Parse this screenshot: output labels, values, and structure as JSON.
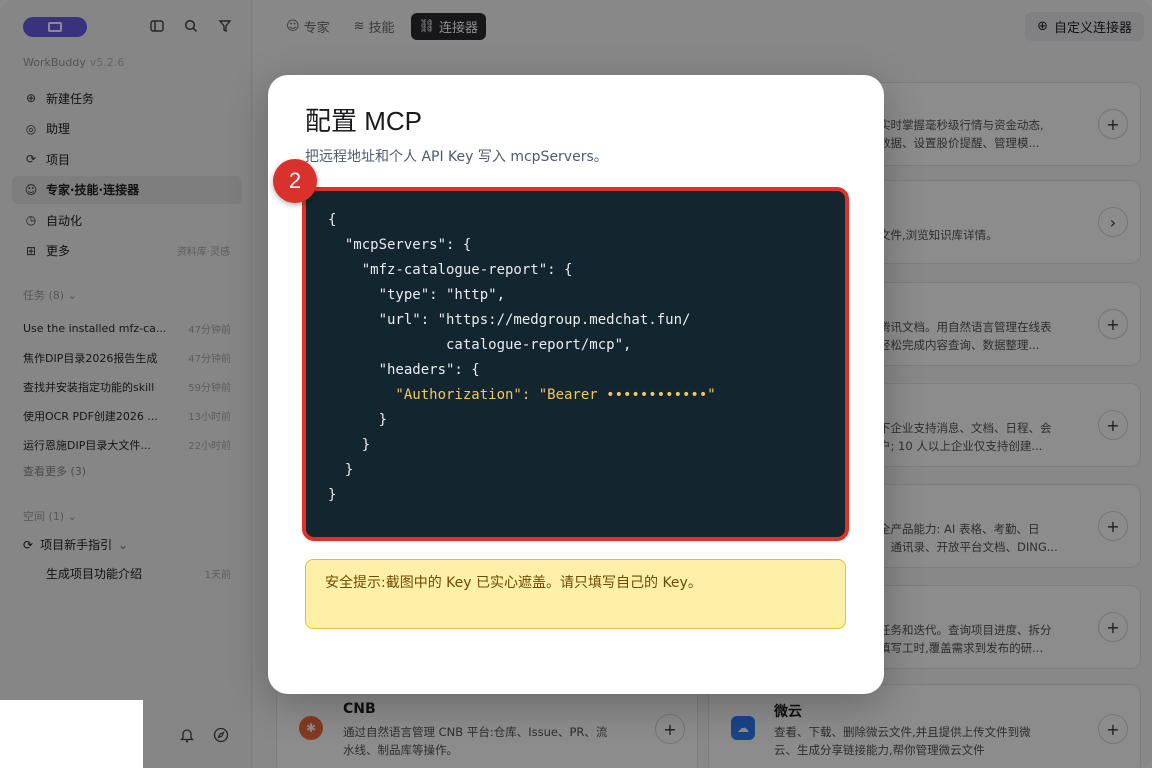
{
  "app": {
    "name": "WorkBuddy",
    "version": "v5.2.6"
  },
  "sidebar": {
    "nav": [
      {
        "label": "新建任务",
        "icon": "plus-circle-icon"
      },
      {
        "label": "助理",
        "icon": "assistant-icon"
      },
      {
        "label": "项目",
        "icon": "project-icon"
      },
      {
        "label": "专家·技能·连接器",
        "icon": "expert-icon"
      },
      {
        "label": "自动化",
        "icon": "clock-icon"
      },
      {
        "label": "更多",
        "icon": "grid-icon",
        "extra": "资料库·灵感"
      }
    ],
    "tasks_header": "任务 (8)",
    "tasks": [
      {
        "title": "Use the installed mfz-ca...",
        "time": "47分钟前"
      },
      {
        "title": "焦作DIP目录2026报告生成",
        "time": "47分钟前"
      },
      {
        "title": "查找并安装指定功能的skill",
        "time": "59分钟前"
      },
      {
        "title": "使用OCR PDF创建2026 ...",
        "time": "13小时前"
      },
      {
        "title": "运行恩施DIP目录大文件...",
        "time": "22小时前"
      }
    ],
    "see_more": "查看更多 (3)",
    "space_header": "空间 (1)",
    "space_item": "项目新手指引",
    "space_sub_item": "生成项目功能介绍",
    "space_sub_time": "1天前"
  },
  "main": {
    "tabs": [
      {
        "label": "专家",
        "icon": "expert-icon"
      },
      {
        "label": "技能",
        "icon": "skill-icon"
      },
      {
        "label": "连接器",
        "icon": "link-icon"
      }
    ],
    "custom_button": "自定义连接器",
    "cards_right": [
      {
        "line1": "实时掌握毫秒级行情与资金动态,",
        "line2": "数据、设置股价提醒、管理模..."
      },
      {
        "line1": "文件,浏览知识库详情。",
        "line2": ""
      },
      {
        "line1": "腾讯文档。用自然语言管理在线表",
        "line2": "轻松完成内容查询、数据整理..."
      },
      {
        "line1": "下企业支持消息、文档、日程、会",
        "line2": "户; 10 人以上企业仅支持创建..."
      },
      {
        "line1": "全产品能力: AI 表格、考勤、日",
        "line2": "、通讯录、开放平台文档、DING..."
      },
      {
        "line1": "任务和迭代。查询项目进度、拆分",
        "line2": "填写工时,覆盖需求到发布的研..."
      }
    ],
    "card_cnb": {
      "title": "CNB",
      "line1": "通过自然语言管理 CNB 平台:仓库、Issue、PR、流",
      "line2": "水线、制品库等操作。"
    },
    "card_weiyun": {
      "title": "微云",
      "line1": "查看、下载、删除微云文件,并且提供上传文件到微",
      "line2": "云、生成分享链接能力,帮你管理微云文件"
    }
  },
  "dialog": {
    "title": "配置 MCP",
    "subtitle": "把远程地址和个人 API Key 写入 mcpServers。",
    "badge": "2",
    "code_lines": [
      "{",
      "  \"mcpServers\": {",
      "    \"mfz-catalogue-report\": {",
      "      \"type\": \"http\",",
      "      \"url\": \"https://medgroup.medchat.fun/",
      "              catalogue-report/mcp\",",
      "      \"headers\": {",
      "        \"Authorization\": \"Bearer ••••••••••••\"",
      "      }",
      "    }",
      "  }",
      "}"
    ],
    "notice": "安全提示:截图中的 Key 已实心遮盖。请只填写自己的 Key。",
    "colors": {
      "highlight_border": "#e0302a",
      "code_bg": "#13252f",
      "notice_bg": "#fff0a8",
      "auth_key": "#f2c661"
    }
  }
}
